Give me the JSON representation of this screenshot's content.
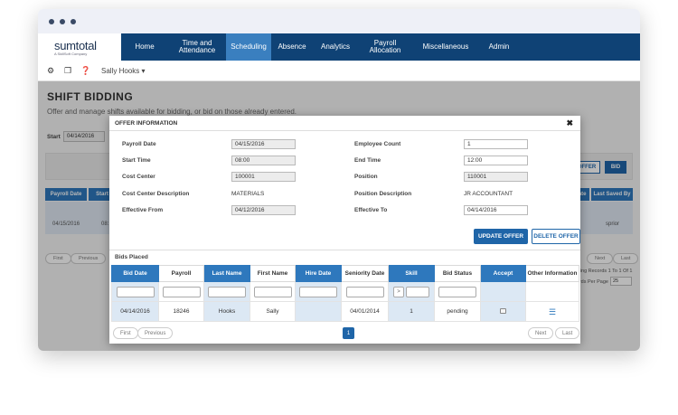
{
  "nav": {
    "logo": "sumtotal",
    "logo_sub": "A SkillSoft Company",
    "items": [
      "Home",
      "Time and\nAttendance",
      "Scheduling",
      "Absence",
      "Analytics",
      "Payroll\nAllocation",
      "Miscellaneous",
      "Admin"
    ]
  },
  "toolbar": {
    "user": "Sally Hooks",
    "dropdown_icon": "▾"
  },
  "page": {
    "title": "SHIFT BIDDING",
    "subtitle": "Offer and manage shifts available for bidding, or bid on those already entered.",
    "start_label": "Start",
    "start_value": "04/14/2016",
    "offer_btn": "OFFER",
    "bid_btn": "BID",
    "col_payroll_date": "Payroll Date",
    "col_start": "Start",
    "col_date": "Date",
    "col_last_saved": "Last Saved By",
    "row_date": "04/15/2016",
    "row_start": "08:",
    "row_saved": "sprior",
    "first": "First",
    "previous": "Previous",
    "next": "Next",
    "last": "Last",
    "paging_info": "Paging Records 1 To 1 Of 1",
    "records_per_page": "Records Per Page",
    "per_page_value": "25"
  },
  "modal": {
    "title": "OFFER INFORMATION",
    "close": "✖",
    "fields": {
      "payroll_date_label": "Payroll Date",
      "payroll_date": "04/15/2016",
      "start_time_label": "Start Time",
      "start_time": "08:00",
      "cost_center_label": "Cost Center",
      "cost_center": "100001",
      "cost_center_desc_label": "Cost Center Description",
      "cost_center_desc": "MATERIALS",
      "effective_from_label": "Effective From",
      "effective_from": "04/12/2016",
      "employee_count_label": "Employee Count",
      "employee_count": "1",
      "end_time_label": "End Time",
      "end_time": "12:00",
      "position_label": "Position",
      "position": "110001",
      "position_desc_label": "Position Description",
      "position_desc": "JR ACCOUNTANT",
      "effective_to_label": "Effective To",
      "effective_to": "04/14/2016"
    },
    "update_btn": "UPDATE OFFER",
    "delete_btn": "DELETE OFFER",
    "bids_title": "Bids Placed",
    "columns": [
      "Bid Date",
      "Payroll",
      "Last Name",
      "First Name",
      "Hire Date",
      "Seniority Date",
      "Skill",
      "Bid Status",
      "Accept",
      "Other Information"
    ],
    "skill_op": ">",
    "row": {
      "bid_date": "04/14/2016",
      "payroll": "18246",
      "last_name": "Hooks",
      "first_name": "Sally",
      "hire_date": "",
      "seniority_date": "04/01/2014",
      "skill": "1",
      "bid_status": "pending"
    },
    "first": "First",
    "previous": "Previous",
    "page": "1",
    "next": "Next",
    "last": "Last"
  }
}
